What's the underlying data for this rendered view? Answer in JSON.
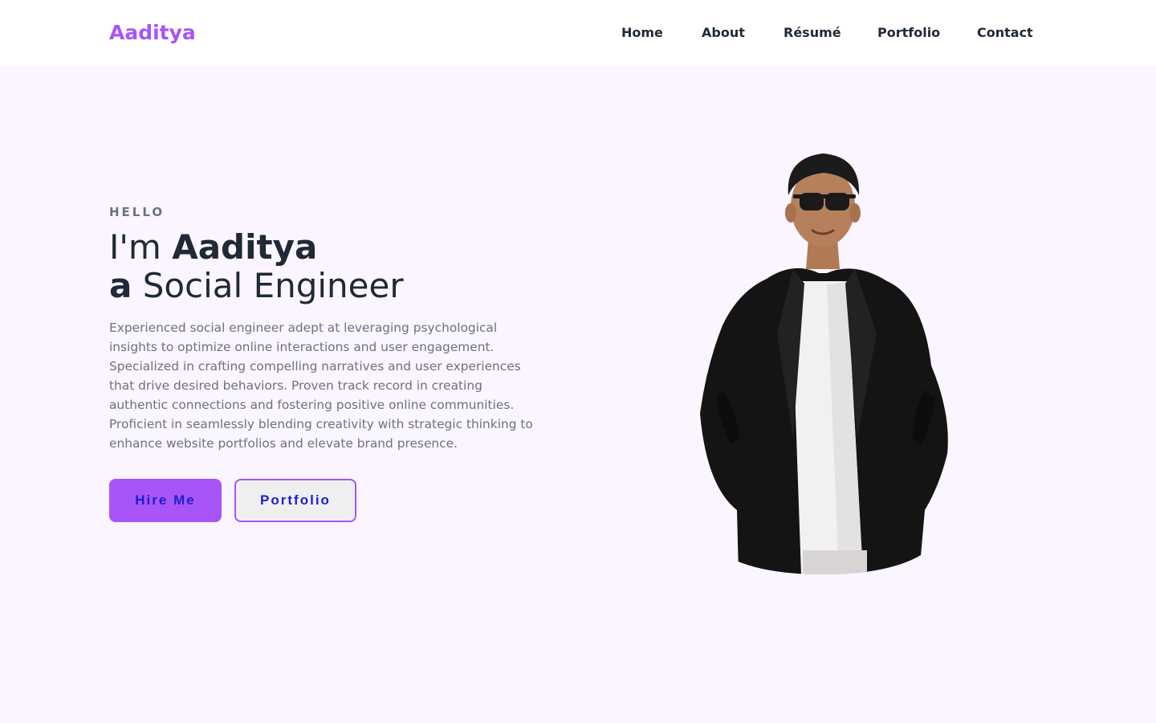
{
  "header": {
    "logo": "Aaditya",
    "nav": [
      {
        "label": "Home"
      },
      {
        "label": "About"
      },
      {
        "label": "Résumé"
      },
      {
        "label": "Portfolio"
      },
      {
        "label": "Contact"
      }
    ]
  },
  "hero": {
    "eyebrow": "HELLO",
    "line1_prefix": "I'm ",
    "line1_name": "Aaditya",
    "line2_prefix": "a",
    "line2_role": " Social Engineer",
    "description": "Experienced social engineer adept at leveraging psychological insights to optimize online interactions and user engagement. Specialized in crafting compelling narratives and user experiences that drive desired behaviors. Proven track record in creating authentic connections and fostering positive online communities. Proficient in seamlessly blending creativity with strategic thinking to enhance website portfolios and elevate brand presence.",
    "buttons": {
      "hire": "Hire Me",
      "portfolio": "Portfolio"
    }
  },
  "colors": {
    "accent": "#a855f7",
    "page_background": "#faf5fe",
    "header_background": "#ffffff",
    "heading_text": "#1f2937",
    "body_text": "#6b7280",
    "button_text": "#1d1dd6"
  },
  "portrait": {
    "icon": "person-portrait-icon"
  }
}
